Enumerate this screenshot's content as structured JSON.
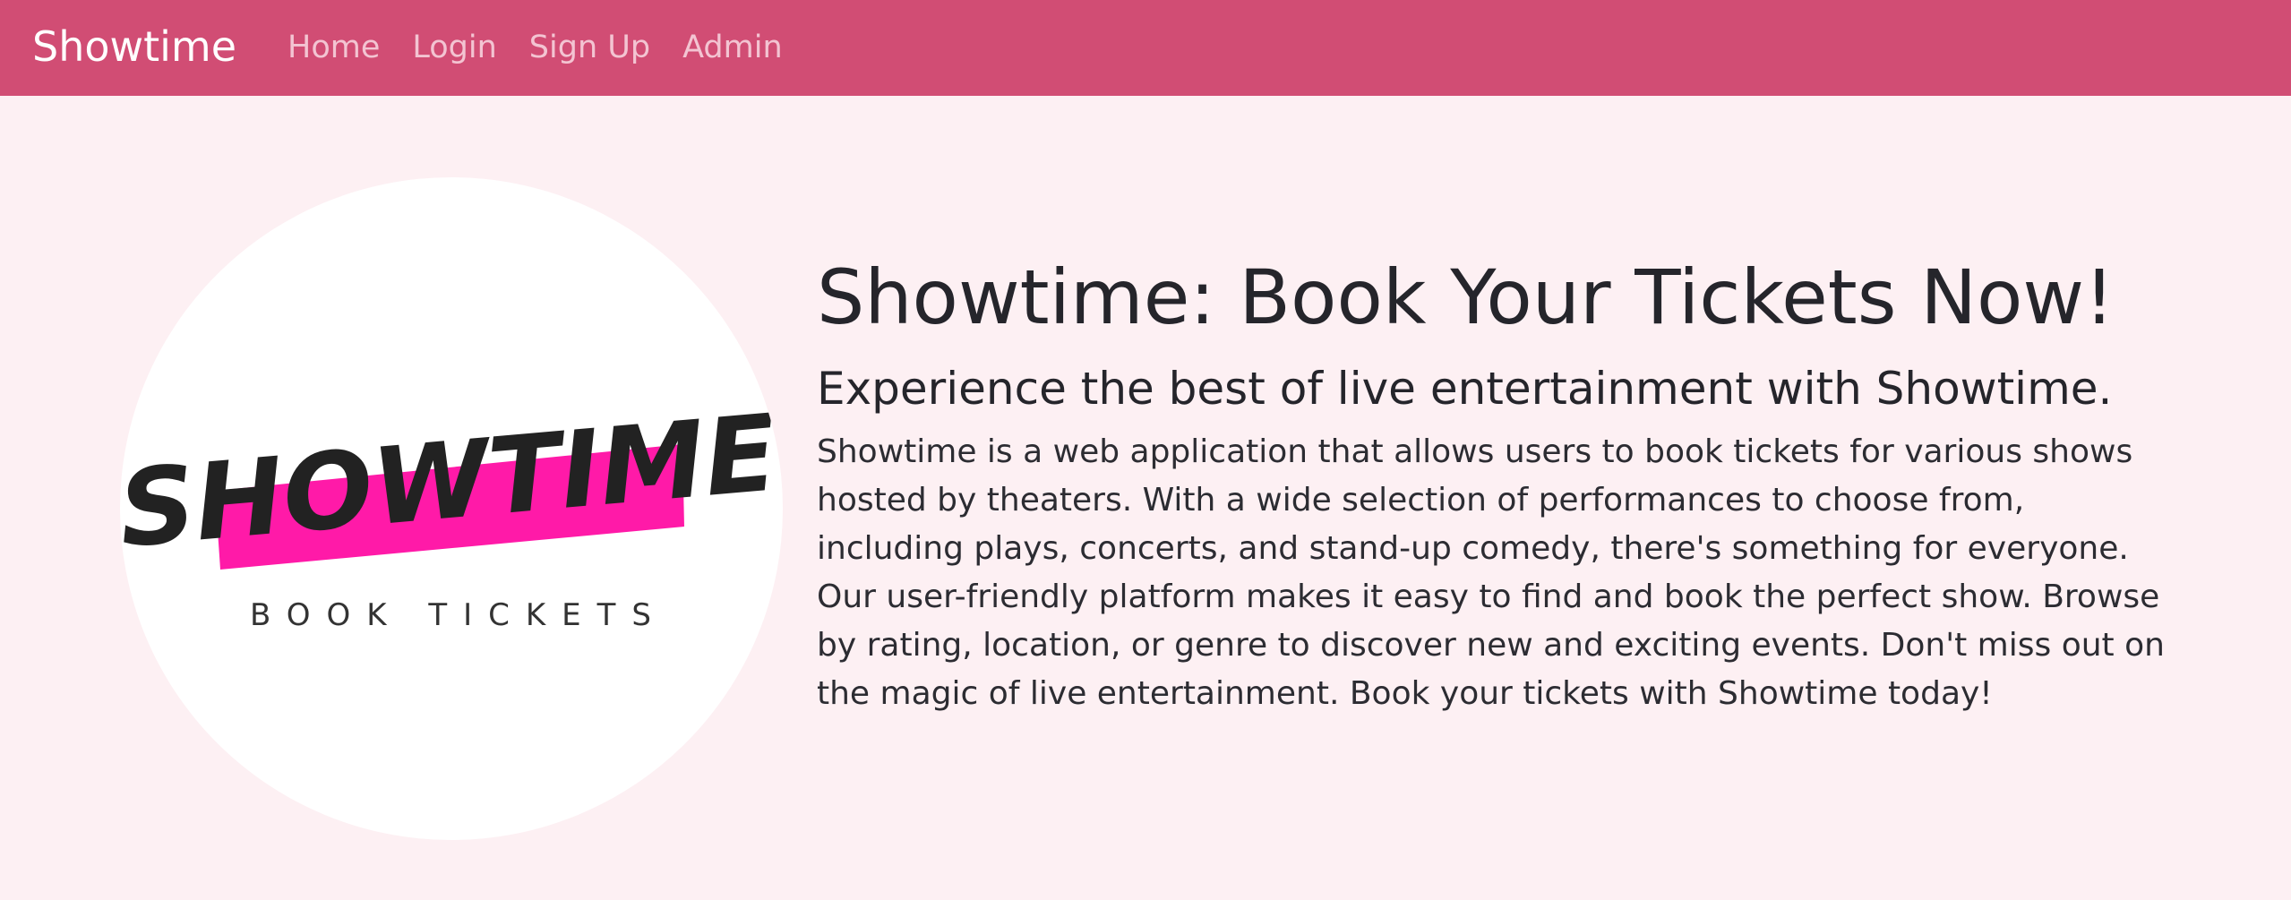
{
  "navbar": {
    "brand": "Showtime",
    "links": [
      "Home",
      "Login",
      "Sign Up",
      "Admin"
    ]
  },
  "logo": {
    "word": "SHOWTIME",
    "tagline": "BOOK TICKETS",
    "accent_color": "#ff1aa8"
  },
  "hero": {
    "title": "Showtime: Book Your Tickets Now!",
    "subtitle": "Experience the best of live entertainment with Showtime.",
    "description": "Showtime is a web application that allows users to book tickets for various shows hosted by theaters. With a wide selection of performances to choose from, including plays, concerts, and stand-up comedy, there's something for everyone. Our user-friendly platform makes it easy to find and book the perfect show. Browse by rating, location, or genre to discover new and exciting events. Don't miss out on the magic of live entertainment. Book your tickets with Showtime today!"
  },
  "colors": {
    "navbar_bg": "#d14d74",
    "page_bg": "#fdf0f3",
    "nav_link": "#f3c4d2"
  }
}
